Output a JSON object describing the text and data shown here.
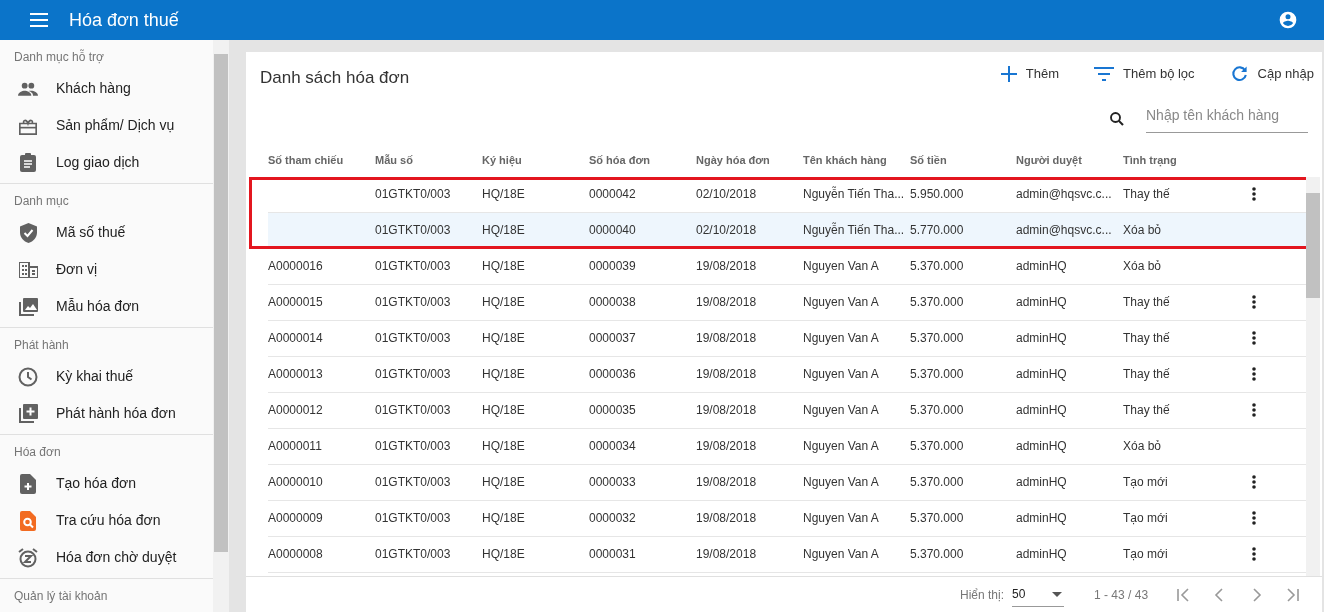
{
  "app_bar": {
    "title": "Hóa đơn thuế"
  },
  "sidebar": {
    "sections": [
      {
        "title": "Danh mục hỗ trợ",
        "items": [
          {
            "label": "Khách hàng"
          },
          {
            "label": "Sản phẩm/ Dịch vụ"
          },
          {
            "label": "Log giao dịch"
          }
        ]
      },
      {
        "title": "Danh mục",
        "items": [
          {
            "label": "Mã số thuế"
          },
          {
            "label": "Đơn vị"
          },
          {
            "label": "Mẫu hóa đơn"
          }
        ]
      },
      {
        "title": "Phát hành",
        "items": [
          {
            "label": "Kỳ khai thuế"
          },
          {
            "label": "Phát hành hóa đơn"
          }
        ]
      },
      {
        "title": "Hóa đơn",
        "items": [
          {
            "label": "Tạo hóa đơn"
          },
          {
            "label": "Tra cứu hóa đơn"
          },
          {
            "label": "Hóa đơn chờ duyệt"
          }
        ]
      },
      {
        "title": "Quản lý tài khoản"
      }
    ]
  },
  "card": {
    "title": "Danh sách hóa đơn",
    "actions": [
      {
        "label": "Thêm"
      },
      {
        "label": "Thêm bộ lọc"
      },
      {
        "label": "Cập nhập"
      }
    ],
    "search": {
      "placeholder": "Nhập tên khách hàng"
    },
    "table": {
      "columns": [
        "Số tham chiếu",
        "Mẫu số",
        "Ký hiệu",
        "Số hóa đơn",
        "Ngày hóa đơn",
        "Tên khách hàng",
        "Số tiền",
        "Người duyệt",
        "Tình trạng"
      ],
      "rows": [
        {
          "cells": [
            "",
            "01GTKT0/003",
            "HQ/18E",
            "0000042",
            "02/10/2018",
            "Nguyễn Tiến Tha...",
            "5.950.000",
            "admin@hqsvc.c...",
            "Thay thế"
          ],
          "menu": true,
          "selected": false,
          "marked": true
        },
        {
          "cells": [
            "",
            "01GTKT0/003",
            "HQ/18E",
            "0000040",
            "02/10/2018",
            "Nguyễn Tiến Tha...",
            "5.770.000",
            "admin@hqsvc.c...",
            "Xóa bỏ"
          ],
          "menu": false,
          "selected": true,
          "marked": true
        },
        {
          "cells": [
            "A0000016",
            "01GTKT0/003",
            "HQ/18E",
            "0000039",
            "19/08/2018",
            "Nguyen Van A",
            "5.370.000",
            "adminHQ",
            "Xóa bỏ"
          ],
          "menu": false,
          "selected": false,
          "marked": false
        },
        {
          "cells": [
            "A0000015",
            "01GTKT0/003",
            "HQ/18E",
            "0000038",
            "19/08/2018",
            "Nguyen Van A",
            "5.370.000",
            "adminHQ",
            "Thay thế"
          ],
          "menu": true,
          "selected": false,
          "marked": false
        },
        {
          "cells": [
            "A0000014",
            "01GTKT0/003",
            "HQ/18E",
            "0000037",
            "19/08/2018",
            "Nguyen Van A",
            "5.370.000",
            "adminHQ",
            "Thay thế"
          ],
          "menu": true,
          "selected": false,
          "marked": false
        },
        {
          "cells": [
            "A0000013",
            "01GTKT0/003",
            "HQ/18E",
            "0000036",
            "19/08/2018",
            "Nguyen Van A",
            "5.370.000",
            "adminHQ",
            "Thay thế"
          ],
          "menu": true,
          "selected": false,
          "marked": false
        },
        {
          "cells": [
            "A0000012",
            "01GTKT0/003",
            "HQ/18E",
            "0000035",
            "19/08/2018",
            "Nguyen Van A",
            "5.370.000",
            "adminHQ",
            "Thay thế"
          ],
          "menu": true,
          "selected": false,
          "marked": false
        },
        {
          "cells": [
            "A0000011",
            "01GTKT0/003",
            "HQ/18E",
            "0000034",
            "19/08/2018",
            "Nguyen Van A",
            "5.370.000",
            "adminHQ",
            "Xóa bỏ"
          ],
          "menu": false,
          "selected": false,
          "marked": false
        },
        {
          "cells": [
            "A0000010",
            "01GTKT0/003",
            "HQ/18E",
            "0000033",
            "19/08/2018",
            "Nguyen Van A",
            "5.370.000",
            "adminHQ",
            "Tạo mới"
          ],
          "menu": true,
          "selected": false,
          "marked": false
        },
        {
          "cells": [
            "A0000009",
            "01GTKT0/003",
            "HQ/18E",
            "0000032",
            "19/08/2018",
            "Nguyen Van A",
            "5.370.000",
            "adminHQ",
            "Tạo mới"
          ],
          "menu": true,
          "selected": false,
          "marked": false
        },
        {
          "cells": [
            "A0000008",
            "01GTKT0/003",
            "HQ/18E",
            "0000031",
            "19/08/2018",
            "Nguyen Van A",
            "5.370.000",
            "adminHQ",
            "Tạo mới"
          ],
          "menu": true,
          "selected": false,
          "marked": false
        }
      ]
    },
    "pagination": {
      "label": "Hiển thị:",
      "page_size": "50",
      "range": "1 - 43 / 43"
    }
  }
}
